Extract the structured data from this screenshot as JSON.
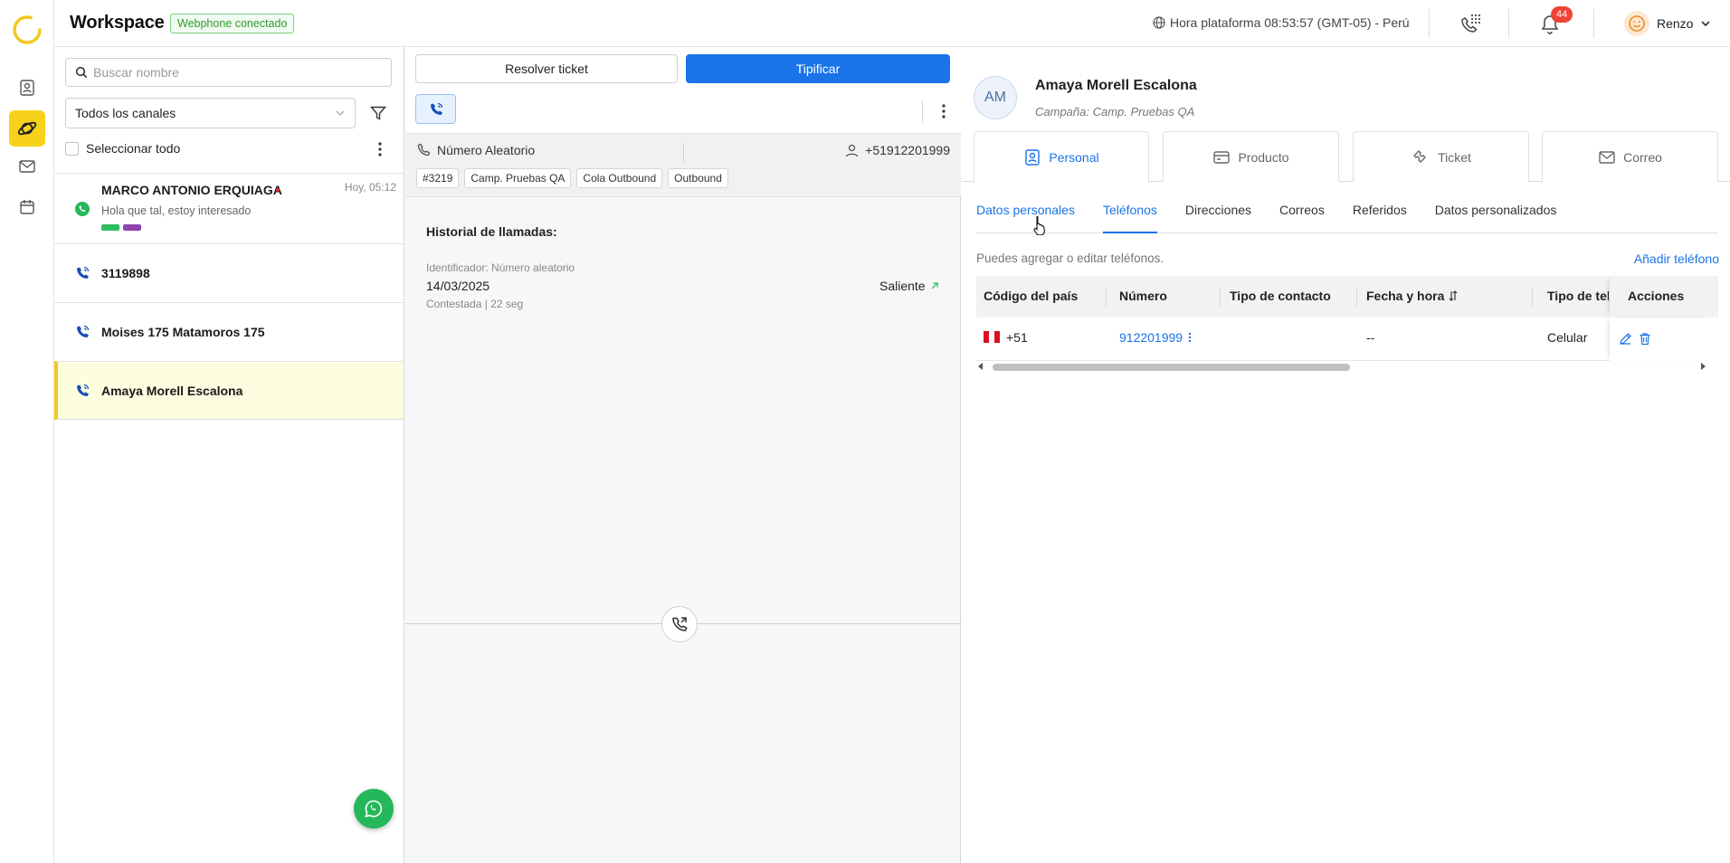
{
  "header": {
    "title": "Workspace",
    "connection_badge": "Webphone conectado",
    "clock": "Hora plataforma 08:53:57 (GMT-05) - Perú",
    "notification_count": "44",
    "user_name": "Renzo"
  },
  "sidebar": {
    "icons": [
      "user-icon",
      "planet-icon",
      "mail-icon",
      "calendar-icon"
    ],
    "active": "planet-icon",
    "accent": "#f6d21a"
  },
  "list": {
    "search_placeholder": "Buscar nombre",
    "channel_filter": "Todos los canales",
    "select_all": "Seleccionar todo",
    "items": [
      {
        "name": "MARCO ANTONIO ERQUIAGA",
        "time": "Hoy, 05:12",
        "preview": "Hola que tal, estoy interesado",
        "channel": "whatsapp",
        "tag_colors": [
          "#2bbd5e",
          "#8e44ad"
        ]
      },
      {
        "name": "3119898",
        "channel": "phone"
      },
      {
        "name": "Moises 175 Matamoros 175",
        "channel": "phone"
      },
      {
        "name": "Amaya Morell Escalona",
        "channel": "phone",
        "active": true
      }
    ]
  },
  "ticket": {
    "resolve_label": "Resolver ticket",
    "classify_label": "Tipificar",
    "random_number_label": "Número Aleatorio",
    "phone": "+51912201999",
    "chips": [
      "#3219",
      "Camp. Pruebas QA",
      "Cola Outbound",
      "Outbound"
    ],
    "history_title": "Historial de llamadas:",
    "history": {
      "identifier": "Identificador: Número aleatorio",
      "date": "14/03/2025",
      "status": "Contestada | 22 seg",
      "direction": "Saliente"
    }
  },
  "contact": {
    "initials": "AM",
    "name": "Amaya Morell Escalona",
    "campaign": "Campaña: Camp. Pruebas QA",
    "section_tabs": [
      "Personal",
      "Producto",
      "Ticket",
      "Correo"
    ],
    "active_section": "Personal",
    "sub_tabs": [
      "Datos personales",
      "Teléfonos",
      "Direcciones",
      "Correos",
      "Referidos",
      "Datos personalizados"
    ],
    "active_sub_tab": "Teléfonos",
    "hint": "Puedes agregar o editar teléfonos.",
    "add_phone": "Añadir teléfono",
    "table": {
      "headers": [
        "Código del país",
        "Número",
        "Tipo de contacto",
        "Fecha y hora",
        "Tipo de tel",
        "Acciones"
      ],
      "rows": [
        {
          "country_code": "+51",
          "number": "912201999",
          "contact_type": "",
          "datetime": "--",
          "phone_type": "Celular"
        }
      ]
    }
  },
  "colors": {
    "primary": "#1a73e8",
    "whatsapp": "#25b85a",
    "alert": "#f04438"
  }
}
